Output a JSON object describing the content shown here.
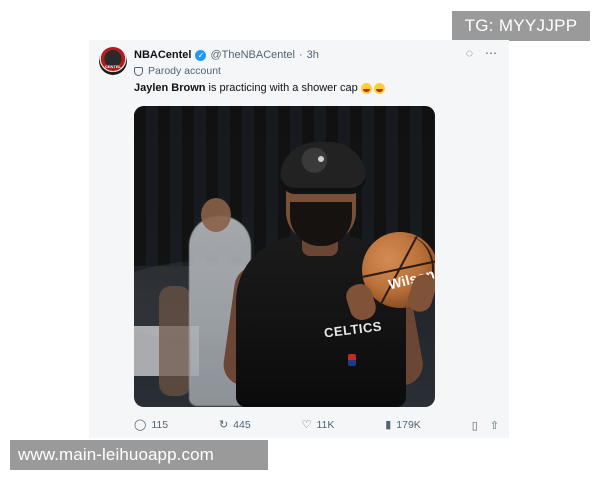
{
  "watermarks": {
    "top": "TG: MYYJJPP",
    "bottom": "www.main-leihuoapp.com"
  },
  "tweet": {
    "author": {
      "display_name": "NBACentel",
      "handle": "@TheNBACentel",
      "time": "3h",
      "badge": "Parody account",
      "avatar_text": "CENTEL"
    },
    "text": {
      "mention": "Jaylen Brown",
      "body": "is practicing with a shower cap"
    },
    "media": {
      "jersey_label": "CELTICS",
      "ball_brand": "Wilson"
    },
    "actions": {
      "replies": "115",
      "reposts": "445",
      "likes": "11K",
      "views": "179K"
    },
    "icons": {
      "grok": "grok-icon",
      "more": "more-icon",
      "parody": "parody-mask-icon",
      "reply": "reply-icon",
      "repost": "repost-icon",
      "like": "like-icon",
      "views": "views-icon",
      "bookmark": "bookmark-icon",
      "share": "share-icon"
    },
    "colors": {
      "verified": "#1d9bf0",
      "card_bg": "#f5f6f7",
      "muted_text": "#536471",
      "watermark_bg": "#9a9a9a"
    }
  }
}
